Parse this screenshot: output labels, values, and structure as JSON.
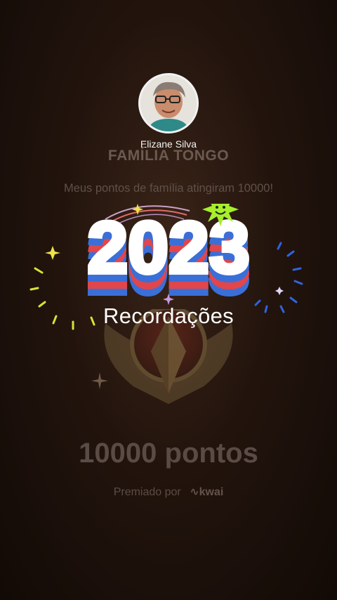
{
  "profile": {
    "author_name": "Elizane Silva"
  },
  "family": {
    "name": "FAMÍLIA TONGO",
    "message": "Meus pontos de família atingiram 10000!"
  },
  "banner": {
    "year": "2023",
    "subtitle": "Recordações"
  },
  "reward": {
    "points_label": "10000 pontos",
    "awarded_by": "Premiado por",
    "brand": "kwai"
  },
  "colors": {
    "background": "#1a0f09",
    "year_fill": "#ffffff",
    "stripe_red": "#e0464b",
    "stripe_blue": "#3a6fd8",
    "smiley": "#a6ef2a"
  }
}
